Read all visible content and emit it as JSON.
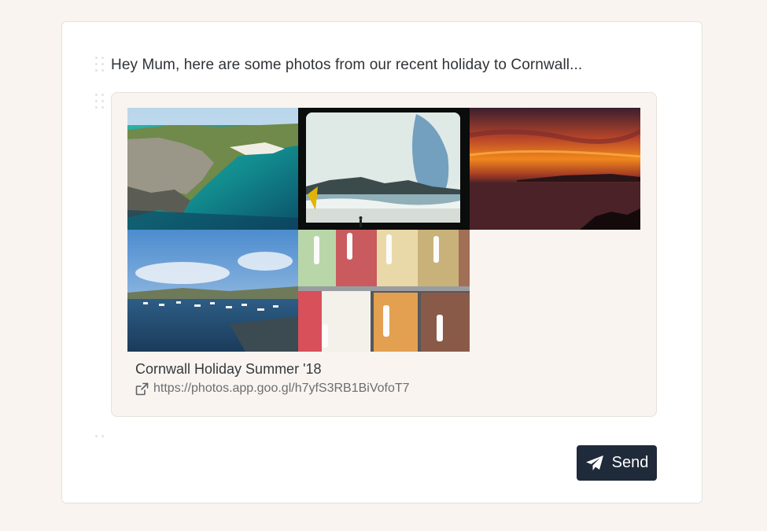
{
  "message": {
    "text": "Hey Mum, here are some photos from our recent holiday to Cornwall..."
  },
  "link_preview": {
    "title": "Cornwall Holiday Summer '18",
    "url": "https://photos.app.goo.gl/h7yfS3RB1BiVofoT7",
    "link_icon": "external-link-icon",
    "photos": [
      {
        "subject": "coastal cliffs and turquoise sea"
      },
      {
        "subject": "surfer on beach, film photo"
      },
      {
        "subject": "sunset over the sea"
      },
      {
        "subject": "harbour with moored boats"
      },
      {
        "subject": "ice cream display"
      }
    ]
  },
  "actions": {
    "send_label": "Send",
    "send_icon": "paper-plane-icon"
  },
  "colors": {
    "page_bg": "#f9f4f0",
    "card_bg": "#ffffff",
    "button_bg": "#1f2a3a"
  }
}
